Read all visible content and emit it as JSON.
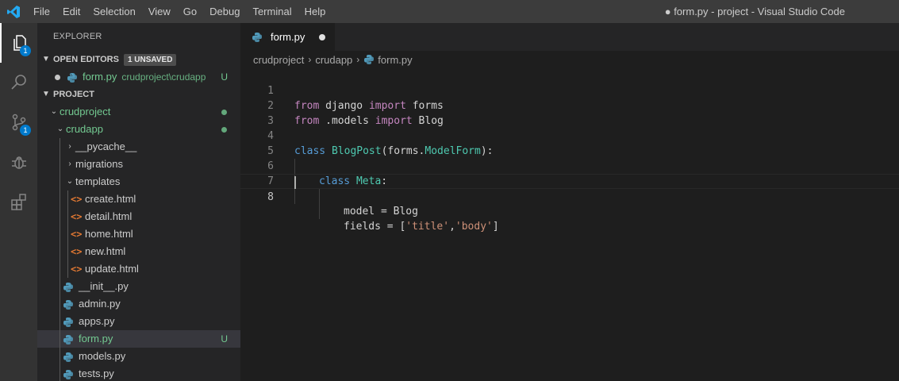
{
  "titlebar": {
    "menu": [
      "File",
      "Edit",
      "Selection",
      "View",
      "Go",
      "Debug",
      "Terminal",
      "Help"
    ],
    "window_title": "● form.py - project - Visual Studio Code"
  },
  "activitybar": {
    "explorer_badge": "1",
    "scm_badge": "1",
    "icons": [
      "files-icon",
      "search-icon",
      "source-control-icon",
      "debug-icon",
      "extensions-icon"
    ]
  },
  "sidebar": {
    "title": "EXPLORER",
    "open_editors": {
      "header": "OPEN EDITORS",
      "badge": "1 UNSAVED",
      "items": [
        {
          "name": "form.py",
          "desc": "crudproject\\crudapp",
          "status": "U"
        }
      ]
    },
    "project": {
      "header": "PROJECT",
      "items": [
        {
          "label": "crudproject"
        },
        {
          "label": "crudapp"
        },
        {
          "label": "__pycache__"
        },
        {
          "label": "migrations"
        },
        {
          "label": "templates"
        },
        {
          "label": "create.html"
        },
        {
          "label": "detail.html"
        },
        {
          "label": "home.html"
        },
        {
          "label": "new.html"
        },
        {
          "label": "update.html"
        },
        {
          "label": "__init__.py"
        },
        {
          "label": "admin.py"
        },
        {
          "label": "apps.py"
        },
        {
          "label": "form.py",
          "status": "U"
        },
        {
          "label": "models.py"
        },
        {
          "label": "tests.py"
        }
      ]
    }
  },
  "tab": {
    "label": "form.py"
  },
  "breadcrumb": [
    "crudproject",
    "crudapp",
    "form.py"
  ],
  "editor": {
    "line_numbers": [
      "1",
      "2",
      "3",
      "4",
      "5",
      "6",
      "7",
      "8"
    ],
    "tokens": {
      "l1": [
        "from",
        " django ",
        "import",
        " forms"
      ],
      "l2": [
        "from",
        " .models ",
        "import",
        " Blog"
      ],
      "l4": [
        "class",
        " ",
        "BlogPost",
        "(forms.",
        "ModelForm",
        "):"
      ],
      "l5": [
        "class",
        " ",
        "Meta",
        ":"
      ],
      "l6": [
        "model",
        " = Blog"
      ],
      "l7": [
        "fields",
        " = [",
        "'title'",
        ",",
        "'body'",
        "]"
      ]
    }
  },
  "colors": {
    "accent": "#007acc",
    "git_untracked": "#73c991",
    "html_icon": "#e37933",
    "python_icon": "#519aba"
  }
}
